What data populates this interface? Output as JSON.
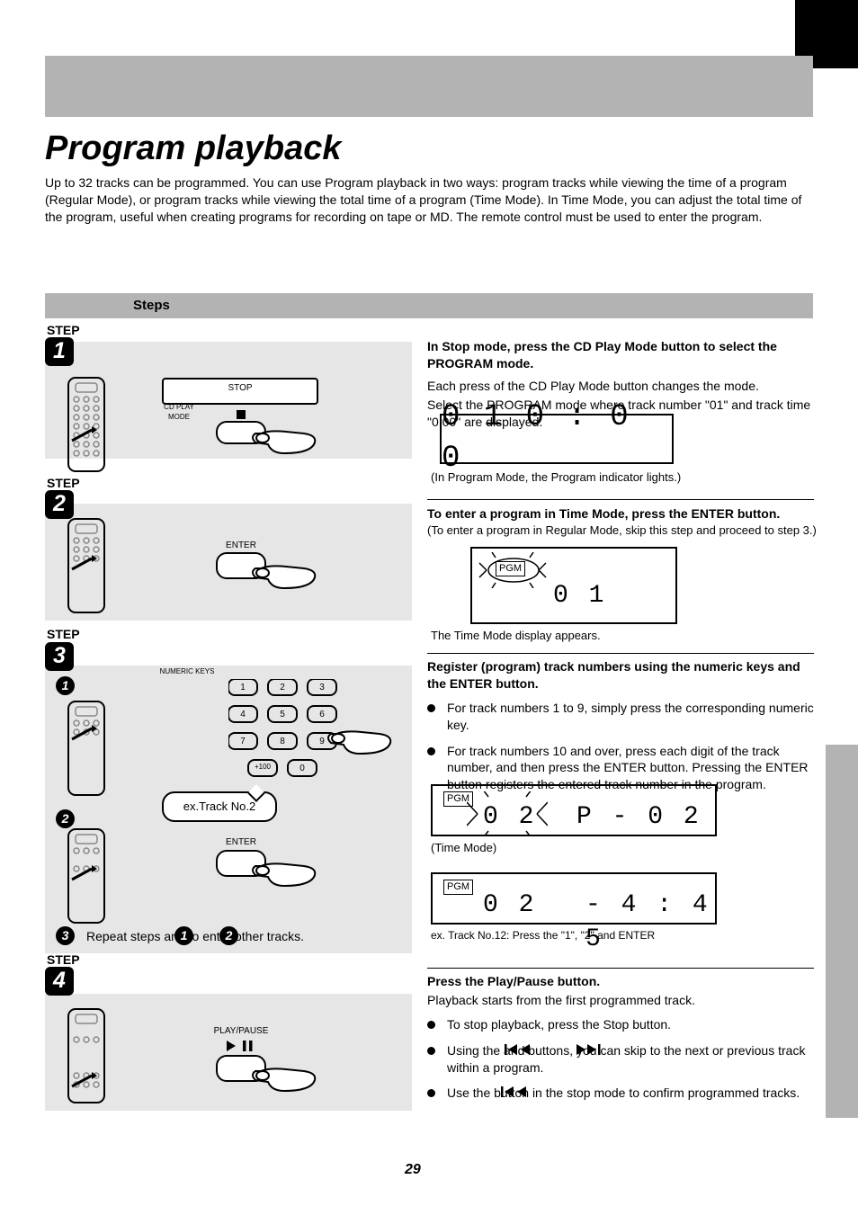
{
  "header": {
    "title": "Program playback",
    "intro": "Up to 32 tracks can be programmed. You can use Program playback in two ways: program tracks while viewing the time of a program (Regular Mode), or program tracks while viewing the total time of a program (Time Mode). In Time Mode, you can adjust the total time of the program, useful when creating programs for recording on tape or MD. The remote control must be used to enter the program.",
    "steps_heading": "Steps",
    "page_number": "29"
  },
  "steps": {
    "s1": {
      "num": "1",
      "title": "In Stop mode, press the CD Play Mode button to select the PROGRAM mode.",
      "btn_label": "CD PLAY MODE",
      "stop_label": "STOP"
    },
    "s2": {
      "num": "2",
      "title": "To enter a program in Time Mode, press the ENTER button.",
      "desc": "(To enter a program in Regular Mode, skip this step and proceed to step 3.)",
      "enter_label": "ENTER"
    },
    "s3": {
      "num": "3",
      "sub1": "1",
      "sub2": "2",
      "sub3": "3",
      "title": "Register (program) track numbers using the numeric keys and the ENTER button.",
      "numkey_label": "NUMERIC KEYS",
      "enter_label": "ENTER",
      "repeat_text": "Repeat steps       and       to enter other tracks.",
      "balloon1": "ex.Track No.2",
      "balloon2": "ex. Track No.12: Press the \"1\", \"2\" and ENTER",
      "k1": "1",
      "k2": "2",
      "k3": "3",
      "k4": "4",
      "k5": "5",
      "k6": "6",
      "k7": "7",
      "k8": "8",
      "k9": "9",
      "k0": "0",
      "kplus": "+100"
    },
    "s4": {
      "num": "4",
      "title": "Press the Play/Pause button.",
      "play_label": "PLAY/PAUSE"
    }
  },
  "rightcol": {
    "r1": {
      "text1": "Each press of the CD Play Mode button changes the mode.",
      "text2": "Select the PROGRAM mode where track number \"01\" and track time \"0:00\" are displayed.",
      "note": "(In Program Mode, the Program indicator lights.)",
      "lcd": "0 1    0 : 0 0"
    },
    "r2": {
      "text1": "The Time Mode display appears.",
      "lcd": "0 1",
      "pgm_label": "PGM"
    },
    "r3": {
      "b1": "For track numbers 1 to 9, simply press the corresponding numeric key.",
      "b2": "For track numbers 10 and over, press each digit of the track number, and then press the ENTER button. Pressing the ENTER button registers the entered track number in the program.",
      "lcd1_left": "0 2",
      "lcd1_right": "P - 0 2",
      "note1": "(Time Mode)",
      "lcd2_left": "0 2",
      "lcd2_right": "- 4 : 4 5",
      "pgm_label": "PGM"
    },
    "r4": {
      "text1": "Playback starts from the first programmed track.",
      "b1": "To stop playback, press the Stop button.",
      "b2": "Using the           and           buttons, you can skip to the next or previous track within a program.",
      "b3": "Use the           button in the stop mode to confirm programmed tracks."
    }
  }
}
